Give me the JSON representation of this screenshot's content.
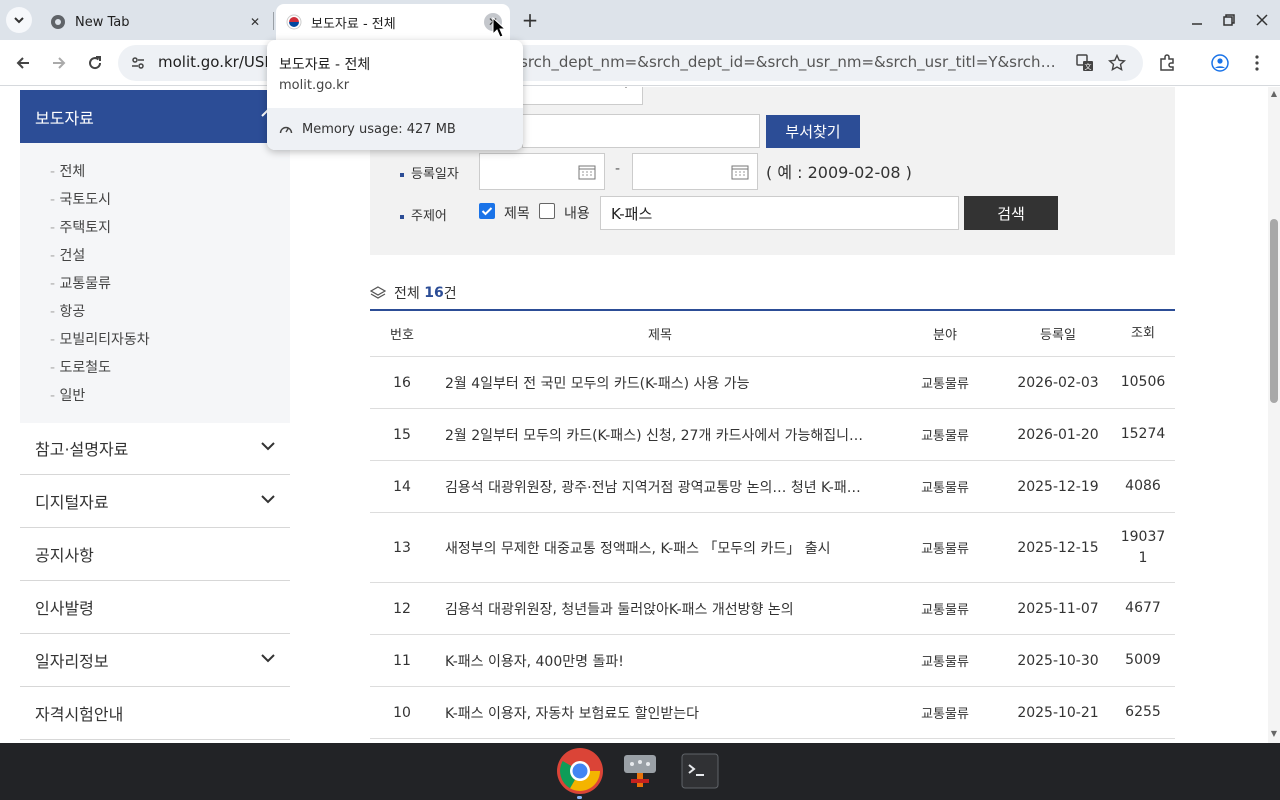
{
  "browser": {
    "tabs": [
      {
        "title": "New Tab",
        "active": false
      },
      {
        "title": "보도자료 - 전체",
        "active": true
      }
    ],
    "url_host": "molit.go.kr/USR",
    "url_tail": "srch_dept_nm=&srch_dept_id=&srch_usr_nm=&srch_usr_titl=Y&srch_usr_...",
    "tooltip": {
      "title": "보도자료 - 전체",
      "host": "molit.go.kr",
      "memory": "Memory usage: 427 MB"
    }
  },
  "sidebar": {
    "header": "보도자료",
    "sub_items": [
      "전체",
      "국토도시",
      "주택토지",
      "건설",
      "교통물류",
      "항공",
      "모빌리티자동차",
      "도로철도",
      "일반"
    ],
    "menu": [
      {
        "label": "참고·설명자료",
        "expandable": true
      },
      {
        "label": "디지털자료",
        "expandable": true
      },
      {
        "label": "공지사항",
        "expandable": false
      },
      {
        "label": "인사발령",
        "expandable": false
      },
      {
        "label": "일자리정보",
        "expandable": true
      },
      {
        "label": "자격시험안내",
        "expandable": false
      }
    ]
  },
  "search": {
    "dept_button": "부서찾기",
    "date_label": "등록일자",
    "date_sep": "-",
    "date_hint": "( 예 : 2009-02-08 )",
    "keyword_label": "주제어",
    "title_check_label": "제목",
    "title_checked": true,
    "content_check_label": "내용",
    "content_checked": false,
    "keyword_value": "K-패스",
    "search_button": "검색"
  },
  "results": {
    "total_prefix": "전체",
    "total_count": "16",
    "total_suffix": "건",
    "columns": {
      "no": "번호",
      "title": "제목",
      "field": "분야",
      "date": "등록일",
      "views": "조회"
    },
    "rows": [
      {
        "no": "16",
        "title": "2월 4일부터 전 국민 모두의 카드(K-패스) 사용 가능",
        "field": "교통물류",
        "date": "2026-02-03",
        "views": "10506"
      },
      {
        "no": "15",
        "title": "2월 2일부터 모두의 카드(K-패스) 신청, 27개 카드사에서 가능해집니…",
        "field": "교통물류",
        "date": "2026-01-20",
        "views": "15274"
      },
      {
        "no": "14",
        "title": "김용석 대광위원장, 광주·전남 지역거점 광역교통망 논의… 청년 K-패…",
        "field": "교통물류",
        "date": "2025-12-19",
        "views": "4086"
      },
      {
        "no": "13",
        "title": "새정부의 무제한 대중교통 정액패스, K-패스 「모두의 카드」 출시",
        "field": "교통물류",
        "date": "2025-12-15",
        "views": "190371"
      },
      {
        "no": "12",
        "title": "김용석 대광위원장, 청년들과 둘러앉아K-패스 개선방향 논의",
        "field": "교통물류",
        "date": "2025-11-07",
        "views": "4677"
      },
      {
        "no": "11",
        "title": "K-패스 이용자, 400만명 돌파!",
        "field": "교통물류",
        "date": "2025-10-30",
        "views": "5009"
      },
      {
        "no": "10",
        "title": "K-패스 이용자, 자동차 보험료도 할인받는다",
        "field": "교통물류",
        "date": "2025-10-21",
        "views": "6255"
      }
    ]
  }
}
